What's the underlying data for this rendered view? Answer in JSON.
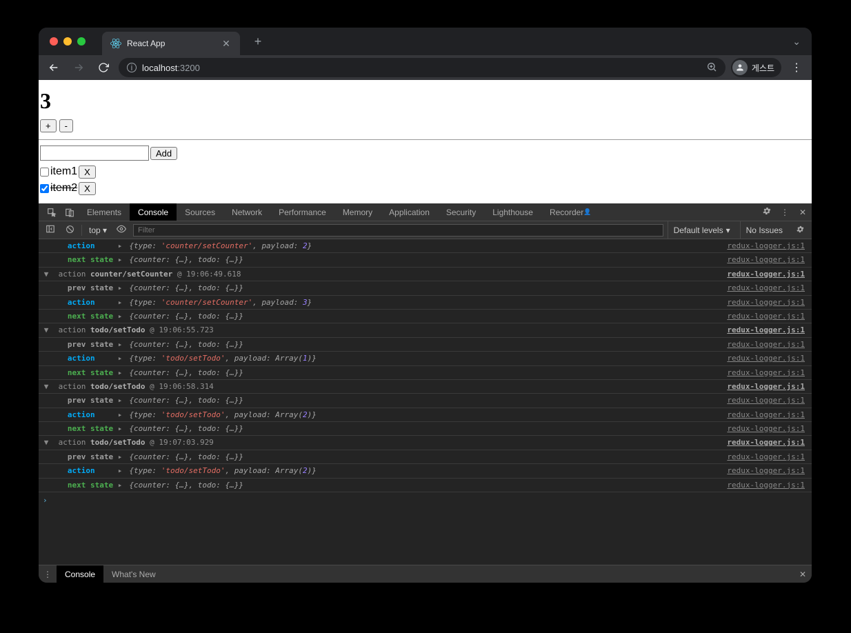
{
  "browser": {
    "tab_title": "React App",
    "url_host": "localhost",
    "url_port": ":3200",
    "profile_label": "게스트"
  },
  "app": {
    "counter_value": "3",
    "inc_label": "+",
    "dec_label": "-",
    "add_label": "Add",
    "todos": [
      {
        "label": "item1",
        "checked": false,
        "del": "X"
      },
      {
        "label": "item2",
        "checked": true,
        "del": "X"
      }
    ]
  },
  "devtools": {
    "tabs": [
      "Elements",
      "Console",
      "Sources",
      "Network",
      "Performance",
      "Memory",
      "Application",
      "Security",
      "Lighthouse",
      "Recorder"
    ],
    "active_tab": "Console",
    "scope": "top",
    "filter_placeholder": "Filter",
    "levels_label": "Default levels",
    "issues_label": "No Issues",
    "drawer_tabs": [
      "Console",
      "What's New"
    ],
    "active_drawer": "Console",
    "source_link": "redux-logger.js:1",
    "logs": [
      {
        "kind": "sub",
        "label": "action",
        "obj": "{type: 'counter/setCounter', payload: 2}"
      },
      {
        "kind": "sub",
        "label": "next state",
        "obj": "{counter: {…}, todo: {…}}"
      },
      {
        "kind": "group",
        "text": "action counter/setCounter @ 19:06:49.618"
      },
      {
        "kind": "sub",
        "label": "prev state",
        "obj": "{counter: {…}, todo: {…}}"
      },
      {
        "kind": "sub",
        "label": "action",
        "obj": "{type: 'counter/setCounter', payload: 3}"
      },
      {
        "kind": "sub",
        "label": "next state",
        "obj": "{counter: {…}, todo: {…}}"
      },
      {
        "kind": "group",
        "text": "action todo/setTodo @ 19:06:55.723"
      },
      {
        "kind": "sub",
        "label": "prev state",
        "obj": "{counter: {…}, todo: {…}}"
      },
      {
        "kind": "sub",
        "label": "action",
        "obj": "{type: 'todo/setTodo', payload: Array(1)}"
      },
      {
        "kind": "sub",
        "label": "next state",
        "obj": "{counter: {…}, todo: {…}}"
      },
      {
        "kind": "group",
        "text": "action todo/setTodo @ 19:06:58.314"
      },
      {
        "kind": "sub",
        "label": "prev state",
        "obj": "{counter: {…}, todo: {…}}"
      },
      {
        "kind": "sub",
        "label": "action",
        "obj": "{type: 'todo/setTodo', payload: Array(2)}"
      },
      {
        "kind": "sub",
        "label": "next state",
        "obj": "{counter: {…}, todo: {…}}"
      },
      {
        "kind": "group",
        "text": "action todo/setTodo @ 19:07:03.929"
      },
      {
        "kind": "sub",
        "label": "prev state",
        "obj": "{counter: {…}, todo: {…}}"
      },
      {
        "kind": "sub",
        "label": "action",
        "obj": "{type: 'todo/setTodo', payload: Array(2)}"
      },
      {
        "kind": "sub",
        "label": "next state",
        "obj": "{counter: {…}, todo: {…}}"
      }
    ]
  }
}
